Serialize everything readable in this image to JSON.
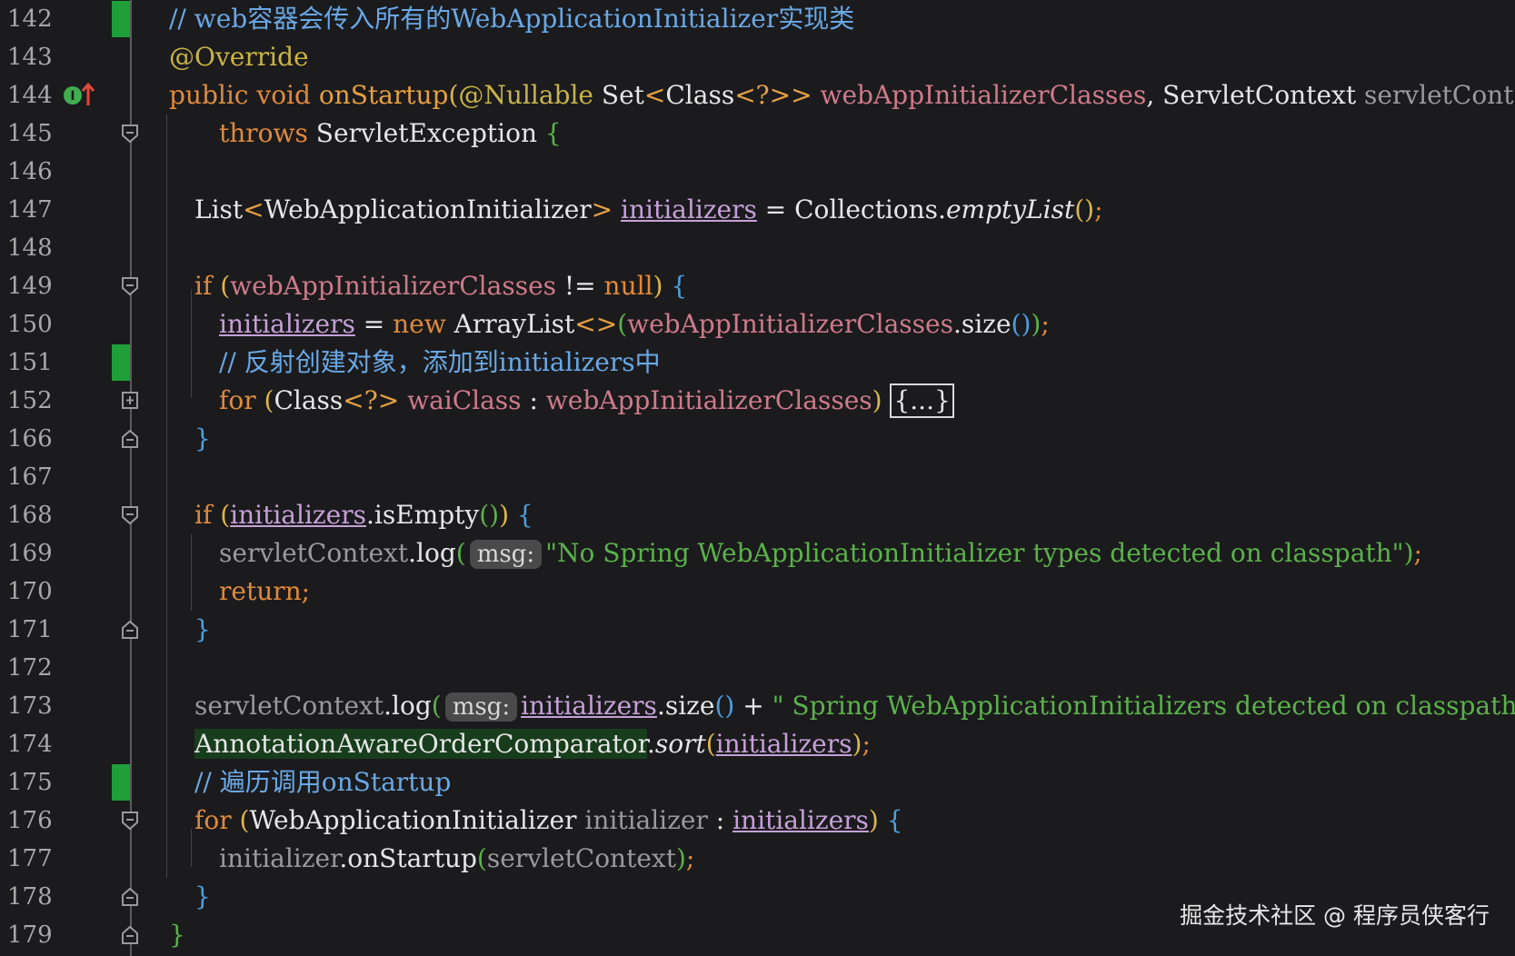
{
  "editor": {
    "lines": [
      {
        "num": "142"
      },
      {
        "num": "143"
      },
      {
        "num": "144"
      },
      {
        "num": "145"
      },
      {
        "num": "146"
      },
      {
        "num": "147"
      },
      {
        "num": "148"
      },
      {
        "num": "149"
      },
      {
        "num": "150"
      },
      {
        "num": "151"
      },
      {
        "num": "152"
      },
      {
        "num": "166"
      },
      {
        "num": "167"
      },
      {
        "num": "168"
      },
      {
        "num": "169"
      },
      {
        "num": "170"
      },
      {
        "num": "171"
      },
      {
        "num": "172"
      },
      {
        "num": "173"
      },
      {
        "num": "174"
      },
      {
        "num": "175"
      },
      {
        "num": "176"
      },
      {
        "num": "177"
      },
      {
        "num": "178"
      },
      {
        "num": "179"
      }
    ],
    "code": {
      "l142_comment": "// web容器会传入所有的WebApplicationInitializer实现类",
      "l143_annotation": "@Override",
      "l144_public": "public void ",
      "l144_method": "onStartup",
      "l144_paren_open": "(",
      "l144_nullable": "@Nullable ",
      "l144_set": "Set",
      "l144_lt": "<",
      "l144_class": "Class",
      "l144_generic": "<?>>",
      "l144_param1": " webAppInitializerClasses",
      "l144_comma": ", ",
      "l144_servletctx": "ServletContext ",
      "l144_param2": "servletContext",
      "l144_paren_close": ")",
      "l145_throws": "throws ",
      "l145_exception": "ServletException ",
      "l145_brace": "{",
      "l147_list": "List",
      "l147_lt": "<",
      "l147_type": "WebApplicationInitializer",
      "l147_gt": "> ",
      "l147_var": "initializers",
      "l147_eq": " = Collections.",
      "l147_empty": "emptyList",
      "l147_call": "()",
      "l147_semi": ";",
      "l149_if": "if ",
      "l149_open": "(",
      "l149_param": "webAppInitializerClasses",
      "l149_neq": " != ",
      "l149_null": "null",
      "l149_close": ") ",
      "l149_brace": "{",
      "l150_var": "initializers",
      "l150_eq": " = ",
      "l150_new": "new ",
      "l150_arraylist": "ArrayList",
      "l150_diamond": "<>",
      "l150_open": "(",
      "l150_param": "webAppInitializerClasses",
      "l150_size": ".size",
      "l150_inner": "()",
      "l150_close": ")",
      "l150_semi": ";",
      "l151_comment": "// 反射创建对象，添加到initializers中",
      "l152_for": "for ",
      "l152_open": "(",
      "l152_class": "Class",
      "l152_generic": "<?> ",
      "l152_var": "waiClass",
      "l152_colon": " : ",
      "l152_param": "webAppInitializerClasses",
      "l152_close": ") ",
      "l152_collapsed": "{...}",
      "l166_brace": "}",
      "l168_if": "if ",
      "l168_open": "(",
      "l168_var": "initializers",
      "l168_isempty": ".isEmpty",
      "l168_call": "()",
      "l168_close": ") ",
      "l168_brace": "{",
      "l169_ctx": "servletContext",
      "l169_log": ".log",
      "l169_open": "(",
      "l169_hint": "msg:",
      "l169_str": "\"No Spring WebApplicationInitializer types detected on classpath\"",
      "l169_close": ")",
      "l169_semi": ";",
      "l170_return": "return;",
      "l171_brace": "}",
      "l173_ctx": "servletContext",
      "l173_log": ".log",
      "l173_open": "(",
      "l173_hint": "msg:",
      "l173_var": "initializers",
      "l173_size": ".size",
      "l173_call": "()",
      "l173_plus": " + ",
      "l173_str": "\" Spring WebApplicationInitializers detected on classpath\"",
      "l173_close": ")",
      "l173_semi": ";",
      "l174_class": "AnnotationAwareOrderComparator",
      "l174_dot": ".",
      "l174_sort": "sort",
      "l174_open": "(",
      "l174_var": "initializers",
      "l174_close": ")",
      "l174_semi": ";",
      "l175_comment": "// 遍历调用onStartup",
      "l176_for": "for ",
      "l176_open": "(",
      "l176_type": "WebApplicationInitializer ",
      "l176_var": "initializer",
      "l176_colon": " : ",
      "l176_list": "initializers",
      "l176_close": ") ",
      "l176_brace": "{",
      "l177_var": "initializer",
      "l177_call": ".onStartup",
      "l177_open": "(",
      "l177_param": "servletContext",
      "l177_close": ")",
      "l177_semi": ";",
      "l178_brace": "}",
      "l179_brace": "}"
    }
  },
  "watermark": "掘金技术社区 @ 程序员侠客行",
  "colors": {
    "background": "#1b1b1d",
    "keyword": "#e08a3c",
    "comment": "#6aa8e6",
    "string": "#5bb24a",
    "annotation": "#c9b446",
    "change_marker": "#1f9e3a"
  },
  "icons": [
    "implements-override-icon",
    "fold-icon",
    "unfold-icon"
  ]
}
